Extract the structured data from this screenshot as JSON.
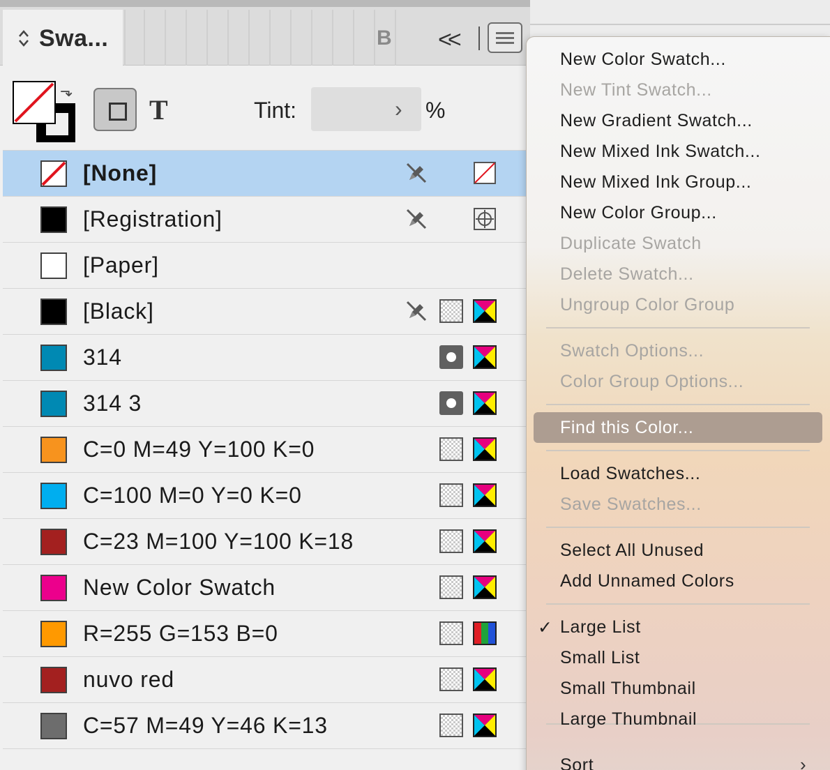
{
  "panel": {
    "tab_label": "Swa...",
    "tab_b_label": "B",
    "collapse_glyph": "<<",
    "tint_label": "Tint:",
    "tint_value": "",
    "tint_unit": "%",
    "text_button": "T",
    "swap_glyph": "⬎"
  },
  "swatches": [
    {
      "name": "[None]",
      "chip": "none",
      "edit_locked": true,
      "mid": "",
      "right": "none",
      "selected": true
    },
    {
      "name": "[Registration]",
      "chip": "#000000",
      "edit_locked": true,
      "mid": "",
      "right": "registration"
    },
    {
      "name": "[Paper]",
      "chip": "#ffffff",
      "edit_locked": false,
      "mid": "",
      "right": ""
    },
    {
      "name": "[Black]",
      "chip": "#000000",
      "edit_locked": true,
      "mid": "process",
      "right": "cmyk"
    },
    {
      "name": "314",
      "chip": "#0089b3",
      "edit_locked": false,
      "mid": "spot",
      "right": "cmyk"
    },
    {
      "name": "314 3",
      "chip": "#0089b3",
      "edit_locked": false,
      "mid": "spot",
      "right": "cmyk"
    },
    {
      "name": "C=0 M=49 Y=100 K=0",
      "chip": "#f7931e",
      "edit_locked": false,
      "mid": "process",
      "right": "cmyk"
    },
    {
      "name": "C=100 M=0 Y=0 K=0",
      "chip": "#00aeef",
      "edit_locked": false,
      "mid": "process",
      "right": "cmyk"
    },
    {
      "name": "C=23 M=100 Y=100 K=18",
      "chip": "#a3201f",
      "edit_locked": false,
      "mid": "process",
      "right": "cmyk"
    },
    {
      "name": "New Color Swatch",
      "chip": "#ec008c",
      "edit_locked": false,
      "mid": "process",
      "right": "cmyk"
    },
    {
      "name": "R=255 G=153 B=0",
      "chip": "#ff9900",
      "edit_locked": false,
      "mid": "process",
      "right": "rgb"
    },
    {
      "name": "nuvo red",
      "chip": "#a3201f",
      "edit_locked": false,
      "mid": "process",
      "right": "cmyk"
    },
    {
      "name": "C=57 M=49 Y=46 K=13",
      "chip": "#6d6d6d",
      "edit_locked": false,
      "mid": "process",
      "right": "cmyk"
    }
  ],
  "menu": {
    "items": [
      {
        "label": "New Color Swatch...",
        "enabled": true
      },
      {
        "label": "New Tint Swatch...",
        "enabled": false
      },
      {
        "label": "New Gradient Swatch...",
        "enabled": true
      },
      {
        "label": "New Mixed Ink Swatch...",
        "enabled": true
      },
      {
        "label": "New Mixed Ink Group...",
        "enabled": true
      },
      {
        "label": "New Color Group...",
        "enabled": true
      },
      {
        "label": "Duplicate Swatch",
        "enabled": false
      },
      {
        "label": "Delete Swatch...",
        "enabled": false
      },
      {
        "label": "Ungroup Color Group",
        "enabled": false
      },
      {
        "label": "Swatch Options...",
        "enabled": false
      },
      {
        "label": "Color Group Options...",
        "enabled": false
      },
      {
        "label": "Find this Color...",
        "enabled": true,
        "highlighted": true
      },
      {
        "label": "Load Swatches...",
        "enabled": true
      },
      {
        "label": "Save Swatches...",
        "enabled": false
      },
      {
        "label": "Select All Unused",
        "enabled": true
      },
      {
        "label": "Add Unnamed Colors",
        "enabled": true
      },
      {
        "label": "Large List",
        "enabled": true,
        "checked": true
      },
      {
        "label": "Small List",
        "enabled": true
      },
      {
        "label": "Small Thumbnail",
        "enabled": true
      },
      {
        "label": "Large Thumbnail",
        "enabled": true
      },
      {
        "label": "Sort",
        "enabled": true,
        "submenu": true
      }
    ],
    "check_glyph": "✓",
    "submenu_glyph": "›"
  },
  "colors": {
    "selection": "#b4d4f2",
    "menu_highlight": "#ad9d91",
    "disabled_text": "#a7a5a2"
  }
}
